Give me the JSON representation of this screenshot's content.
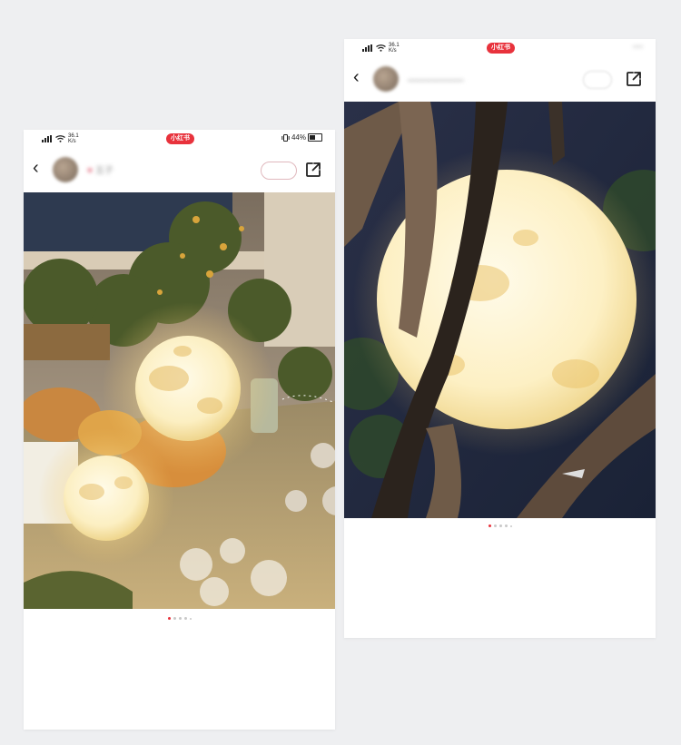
{
  "status_bar": {
    "speed_value": "36.1",
    "speed_unit": "K/s",
    "app_badge": "小红书",
    "battery_percent": "44%"
  },
  "left_screen": {
    "username": "五子",
    "carousel": {
      "total_dots": 5,
      "active_index": 0
    }
  },
  "right_screen": {
    "carousel": {
      "total_dots": 5,
      "active_index": 0
    }
  },
  "icons": [
    "back-chevron-icon",
    "avatar",
    "heart-icon",
    "follow-button",
    "share-icon",
    "wifi-icon",
    "signal-icon",
    "battery-icon",
    "vibrate-icon"
  ],
  "colors": {
    "accent": "#e8323c",
    "background": "#eeeff1"
  }
}
